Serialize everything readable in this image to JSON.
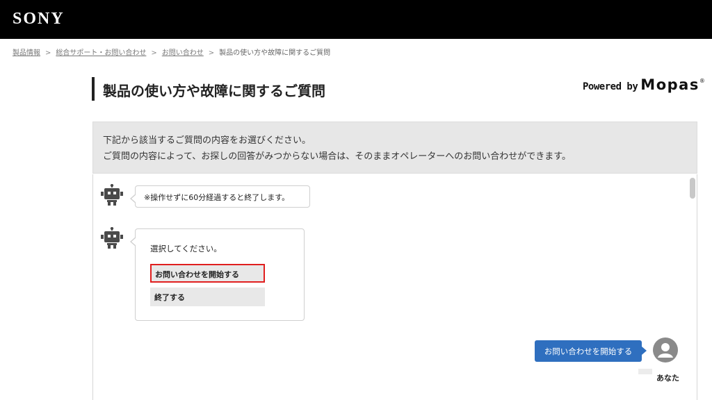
{
  "header": {
    "logo": "SONY"
  },
  "breadcrumb": {
    "items": [
      "製品情報",
      "総合サポート・お問い合わせ",
      "お問い合わせ"
    ],
    "current": "製品の使い方や故障に関するご質問",
    "separator": ">"
  },
  "page": {
    "title": "製品の使い方や故障に関するご質問",
    "powered_prefix": "Powered by",
    "powered_brand": "Mopas",
    "powered_reg": "®"
  },
  "notice": {
    "line1": "下記から該当するご質問の内容をお選びください。",
    "line2": "ご質問の内容によって、お探しの回答がみつからない場合は、そのままオペレーターへのお問い合わせができます。"
  },
  "chat": {
    "bot_icon": "robot-icon",
    "bot_message_1": "※操作せずに60分経過すると終了します。",
    "bot_prompt": "選択してください。",
    "options": [
      "お問い合わせを開始する",
      "終了する"
    ],
    "user_message": "お問い合わせを開始する",
    "user_name": "あなた",
    "user_icon": "user-avatar-icon"
  },
  "colors": {
    "header_bg": "#000000",
    "user_bubble": "#2f6fbf",
    "highlight_border": "#e01e1e",
    "notice_bg": "#e7e7e7"
  }
}
